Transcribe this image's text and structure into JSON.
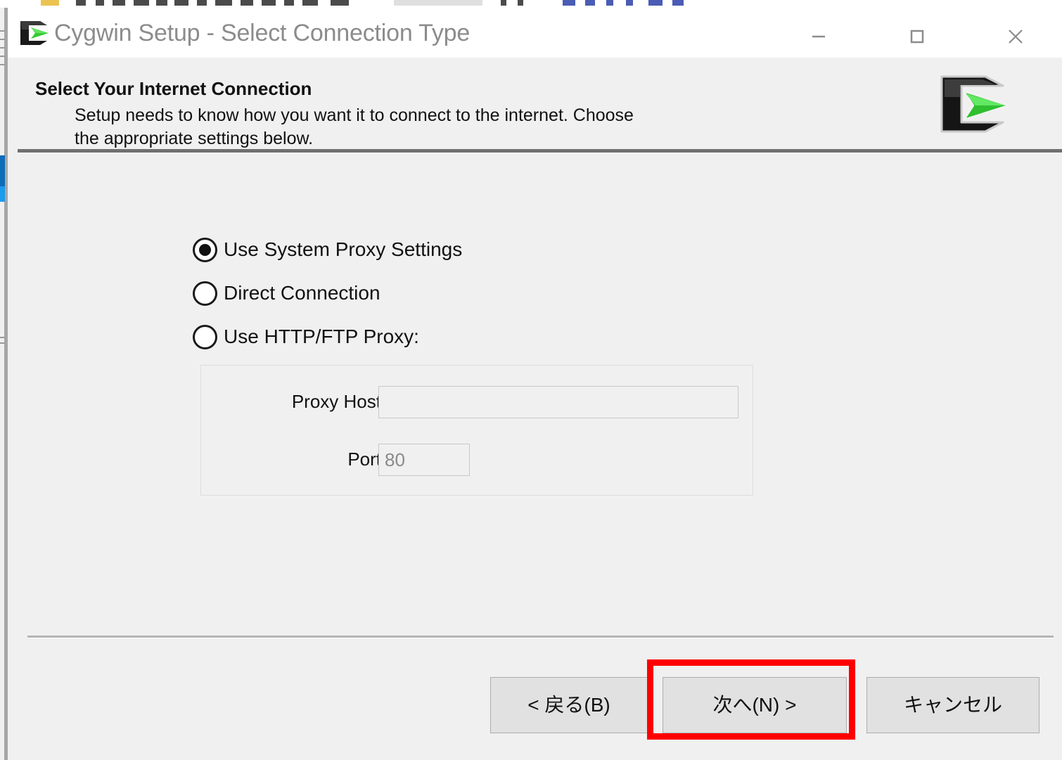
{
  "window": {
    "title": "Cygwin Setup - Select Connection Type",
    "icon": "cygwin-logo-icon",
    "controls": {
      "minimize": "minimize-icon",
      "maximize": "maximize-icon",
      "close": "close-icon"
    }
  },
  "header": {
    "title": "Select Your Internet Connection",
    "description_line1": "Setup needs to know how you want it to connect to the internet.  Choose",
    "description_line2": "the appropriate settings below.",
    "logo": "cygwin-logo-icon"
  },
  "connection_options": [
    {
      "label": "Use System Proxy Settings",
      "selected": true
    },
    {
      "label": "Direct Connection",
      "selected": false
    },
    {
      "label": "Use HTTP/FTP Proxy:",
      "selected": false
    }
  ],
  "proxy_group": {
    "host_label": "Proxy Host",
    "host_value": "",
    "host_placeholder": "",
    "port_label": "Port",
    "port_value": "80",
    "enabled": false
  },
  "footer": {
    "back_label": "< 戻る(B)",
    "next_label": "次へ(N) >",
    "cancel_label": "キャンセル",
    "highlighted_button": "次へ(N) >"
  },
  "colors": {
    "dialog_background": "#f0f0f0",
    "titlebar_background": "#ffffff",
    "title_text": "#8c8c8c",
    "body_text": "#111111",
    "button_face": "#e1e1e1",
    "button_border": "#adadad",
    "disabled_text": "#8a8a8a",
    "highlight_red": "#ff0000",
    "logo_green": "#33cc33",
    "logo_black": "#1a1a1a"
  }
}
